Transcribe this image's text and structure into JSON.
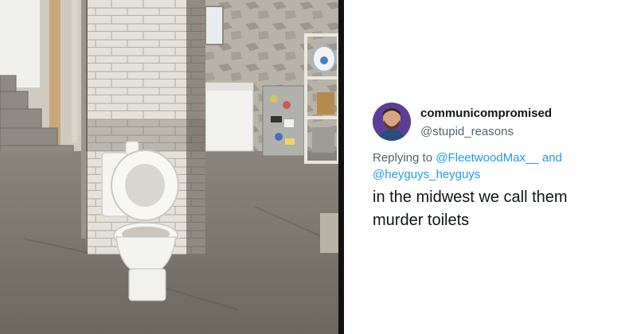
{
  "photo": {
    "alt_subject": "basement toilet",
    "icon": "toilet-photo"
  },
  "tweet": {
    "display_name": "communicompromised",
    "handle": "@stupid_reasons",
    "reply_prefix": "Replying to ",
    "mention_1": "@FleetwoodMax__",
    "mention_joiner": " and",
    "mention_2": "@heyguys_heyguys",
    "text_line_1": "in the midwest we call them",
    "text_line_2": "murder toilets"
  },
  "colors": {
    "name": "#0f1419",
    "secondary": "#536471",
    "mention": "#1d9bf0",
    "divider": "#111111"
  }
}
